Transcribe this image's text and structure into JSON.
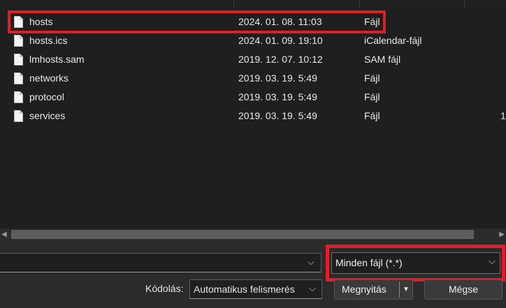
{
  "files": [
    {
      "name": "hosts",
      "date": "2024. 01. 08. 11:03",
      "type": "Fájl",
      "size": ""
    },
    {
      "name": "hosts.ics",
      "date": "2024. 01. 09. 19:10",
      "type": "iCalendar-fájl",
      "size": ""
    },
    {
      "name": "lmhosts.sam",
      "date": "2019. 12. 07. 10:12",
      "type": "SAM fájl",
      "size": ""
    },
    {
      "name": "networks",
      "date": "2019. 03. 19. 5:49",
      "type": "Fájl",
      "size": ""
    },
    {
      "name": "protocol",
      "date": "2019. 03. 19. 5:49",
      "type": "Fájl",
      "size": ""
    },
    {
      "name": "services",
      "date": "2019. 03. 19. 5:49",
      "type": "Fájl",
      "size": "1"
    }
  ],
  "footer": {
    "filename_value": "",
    "filter_value": "Minden fájl  (*.*)",
    "encoding_label": "Kódolás:",
    "encoding_value": "Automatikus felismerés",
    "open_label": "Megnyitás",
    "cancel_label": "Mégse"
  },
  "icons": {
    "file": "file-icon",
    "dropdown": "chevron-down-icon",
    "scroll_left": "scroll-left-arrow-icon",
    "scroll_right": "scroll-right-arrow-icon"
  },
  "colors": {
    "highlight": "#e01e2a",
    "background": "#1f1f1f",
    "panel": "#2b2b2b"
  }
}
